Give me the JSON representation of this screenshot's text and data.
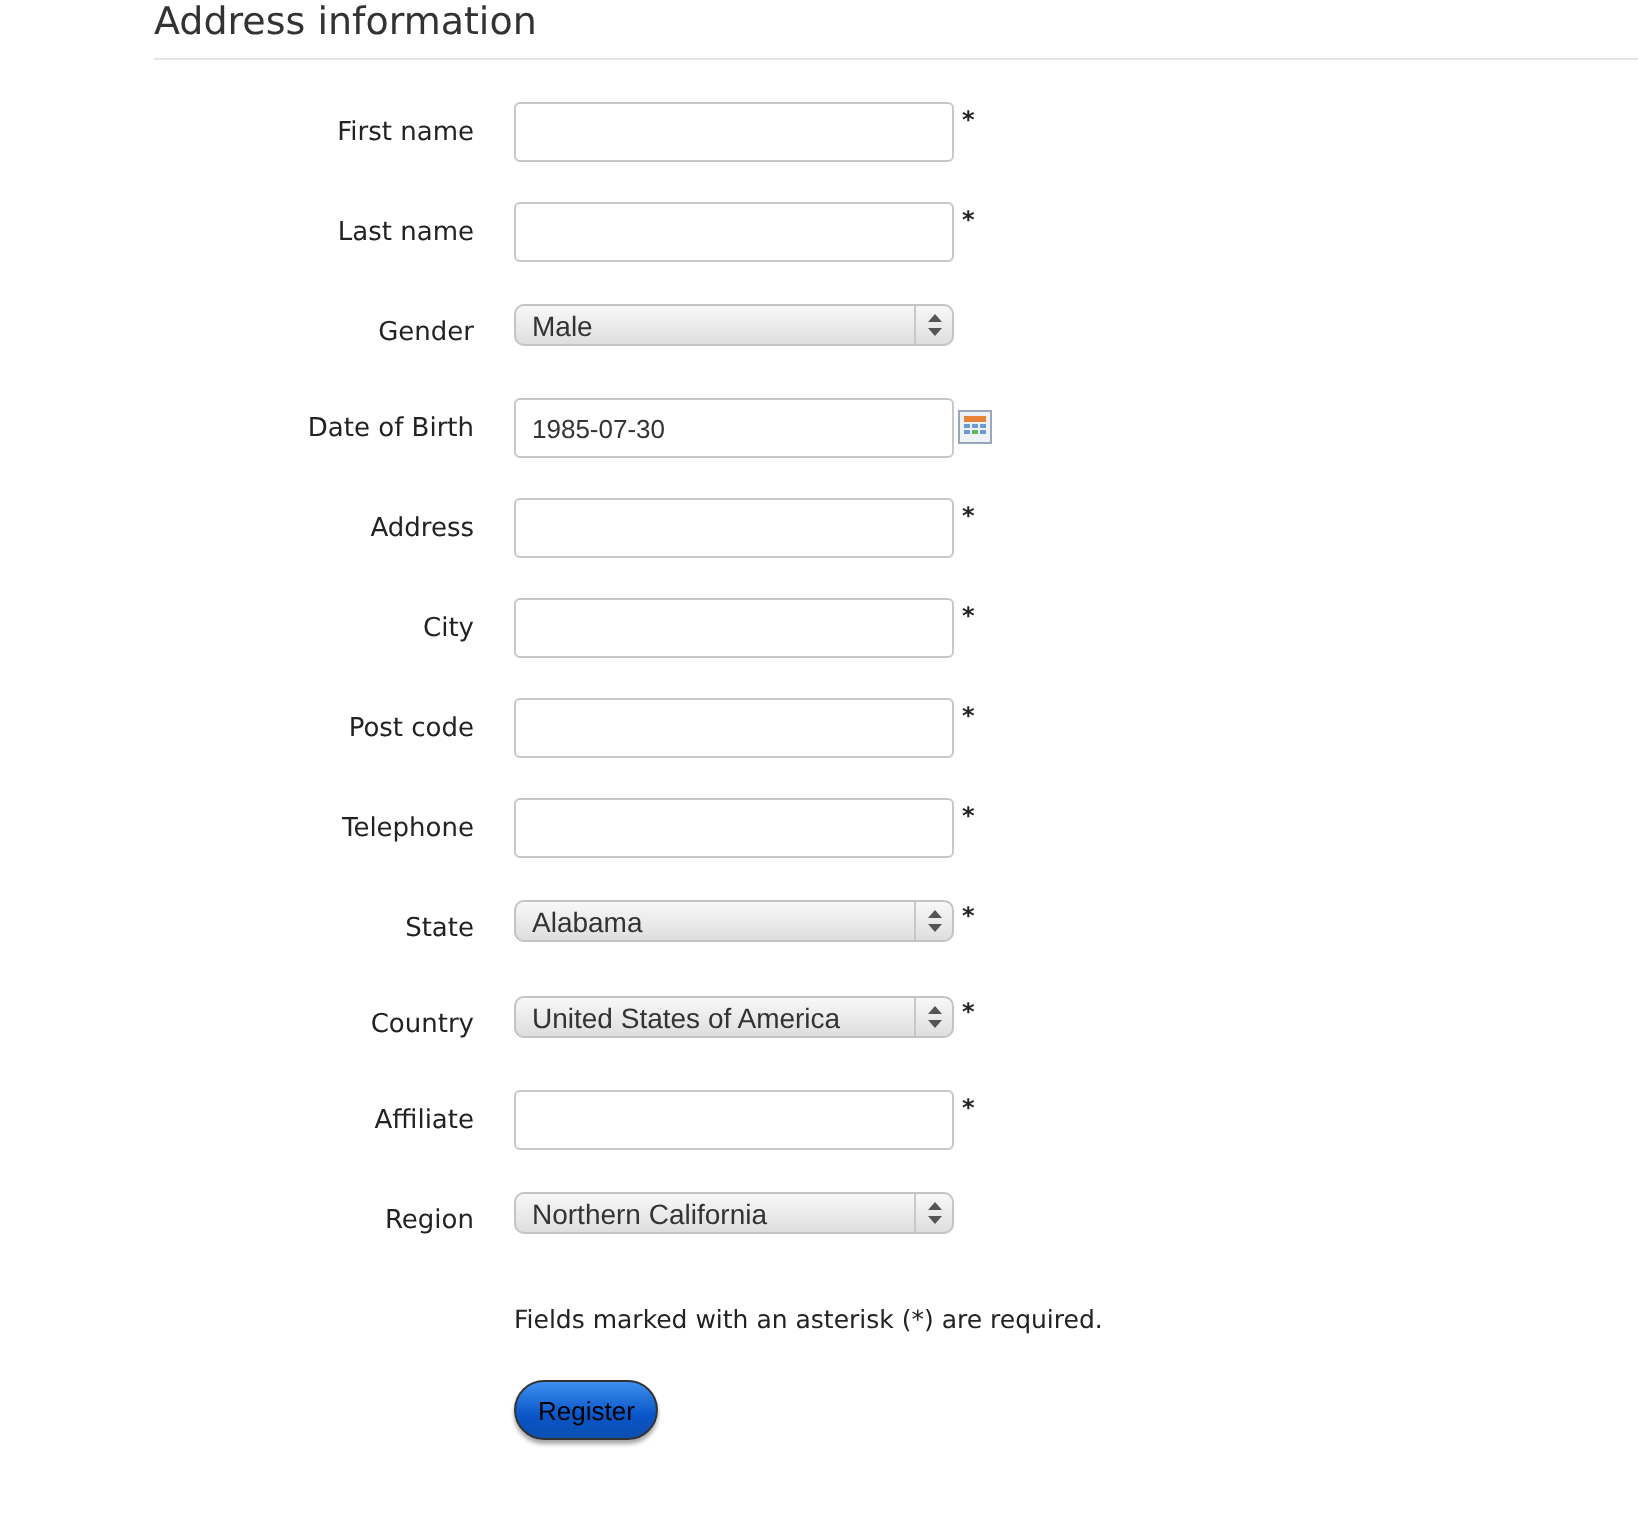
{
  "heading": "Address information",
  "required_mark": "*",
  "fields": [
    {
      "label": "First name",
      "kind": "text",
      "required": true
    },
    {
      "label": "Last name",
      "kind": "text",
      "required": true
    },
    {
      "label": "Gender",
      "kind": "select",
      "value": "Male",
      "required": false
    },
    {
      "label": "Date of Birth",
      "kind": "date",
      "value": "1985-07-30",
      "required": false
    },
    {
      "label": "Address",
      "kind": "text",
      "required": true
    },
    {
      "label": "City",
      "kind": "text",
      "required": true
    },
    {
      "label": "Post code",
      "kind": "text",
      "required": true
    },
    {
      "label": "Telephone",
      "kind": "text",
      "required": true
    },
    {
      "label": "State",
      "kind": "select",
      "value": "Alabama",
      "required": true
    },
    {
      "label": "Country",
      "kind": "select",
      "value": "United States of America",
      "required": true
    },
    {
      "label": "Affiliate",
      "kind": "text",
      "required": true
    },
    {
      "label": "Region",
      "kind": "select",
      "value": "Northern California",
      "required": false
    }
  ],
  "note": "Fields marked with an asterisk (*) are required.",
  "submit": "Register"
}
